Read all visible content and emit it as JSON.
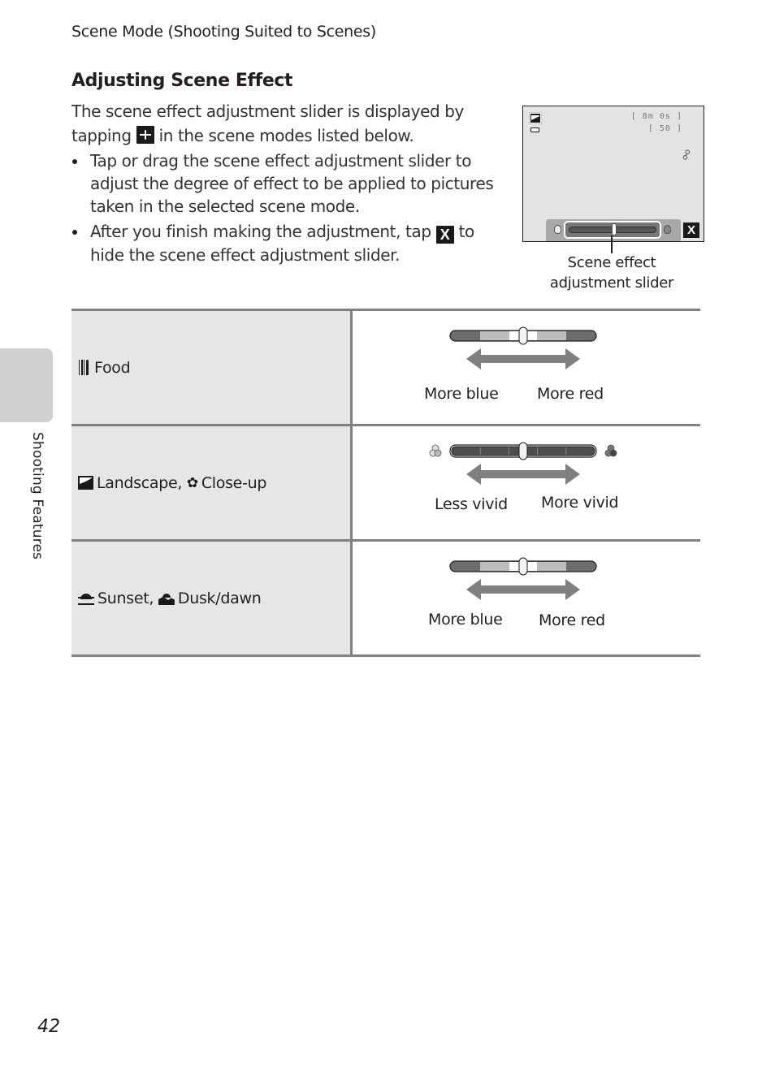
{
  "header": {
    "running_title": "Scene Mode (Shooting Suited to Scenes)",
    "section_title": "Adjusting Scene Effect"
  },
  "intro": {
    "text_before_icon": "The scene effect adjustment slider is displayed by tapping",
    "icon": "scene-effect-icon",
    "text_after_icon": "in the scene modes listed below."
  },
  "bullets": [
    {
      "text": "Tap or drag the scene effect adjustment slider to adjust the degree of effect to be applied to pictures taken in the selected scene mode."
    },
    {
      "text_before_icon": "After you finish making the adjustment, tap",
      "icon_label": "X",
      "text_after_icon": "to hide the scene effect adjustment slider."
    }
  ],
  "camera_screen": {
    "remaining_time": "[  8m 0s ]",
    "remaining_shots": "[   50 ]",
    "close_label": "X",
    "callout": "Scene effect adjustment slider"
  },
  "table": {
    "rows": [
      {
        "modes": [
          {
            "icon": "food-icon",
            "label": "Food"
          }
        ],
        "slider_type": "color",
        "slider_position": 0.5,
        "left_label": "More blue",
        "right_label": "More red"
      },
      {
        "modes": [
          {
            "icon": "landscape-icon",
            "label": "Landscape,"
          },
          {
            "icon": "close-up-icon",
            "label": "Close-up"
          }
        ],
        "slider_type": "vivid",
        "slider_position": 0.5,
        "left_label": "Less vivid",
        "right_label": "More vivid"
      },
      {
        "modes": [
          {
            "icon": "sunset-icon",
            "label": "Sunset,"
          },
          {
            "icon": "dusk-dawn-icon",
            "label": "Dusk/dawn"
          }
        ],
        "slider_type": "color",
        "slider_position": 0.5,
        "left_label": "More blue",
        "right_label": "More red"
      }
    ]
  },
  "side_tab": {
    "label": "Shooting Features"
  },
  "page_number": "42"
}
